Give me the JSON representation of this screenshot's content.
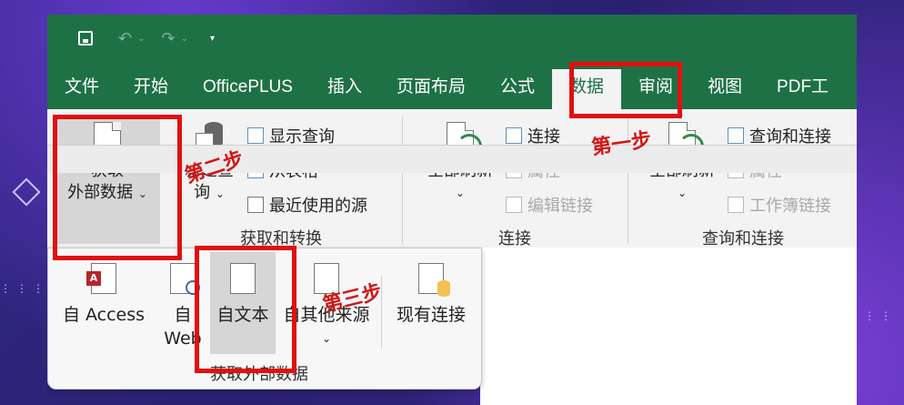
{
  "quick_access": {
    "undo_icon": "undo-icon",
    "redo_icon": "redo-icon",
    "save_icon": "save-icon"
  },
  "tabs": [
    "文件",
    "开始",
    "OfficePLUS",
    "插入",
    "页面布局",
    "公式",
    "数据",
    "审阅",
    "视图",
    "PDF工"
  ],
  "active_tab": "数据",
  "ribbon": {
    "get_external": {
      "line1": "获取",
      "line2": "外部数据"
    },
    "new_query": {
      "line1": "新建查",
      "line2": "询"
    },
    "show_query": "显示查询",
    "from_table": "从表格",
    "recent_sources": "最近使用的源",
    "group1_label": "获取和转换",
    "refresh_all": "全部刷新",
    "connections": "连接",
    "properties": "属性",
    "edit_links": "编辑链接",
    "group2_label": "连接",
    "refresh_all2": "全部刷新",
    "queries_connections": "查询和连接",
    "properties2": "属性",
    "workbook_links": "工作簿链接",
    "group3_label": "查询和连接"
  },
  "dropdown": {
    "from_access": "自 Access",
    "from_web_line1": "自",
    "from_web_line2": "Web",
    "from_text": "自文本",
    "from_other": "自其他来源",
    "existing_connections": "现有连接",
    "group_label": "获取外部数据"
  },
  "annotations": {
    "step1": "第一步",
    "step2": "第二步",
    "step3": "第三步"
  },
  "colors": {
    "excel_green": "#1e7145",
    "highlight_red": "#e01010"
  }
}
